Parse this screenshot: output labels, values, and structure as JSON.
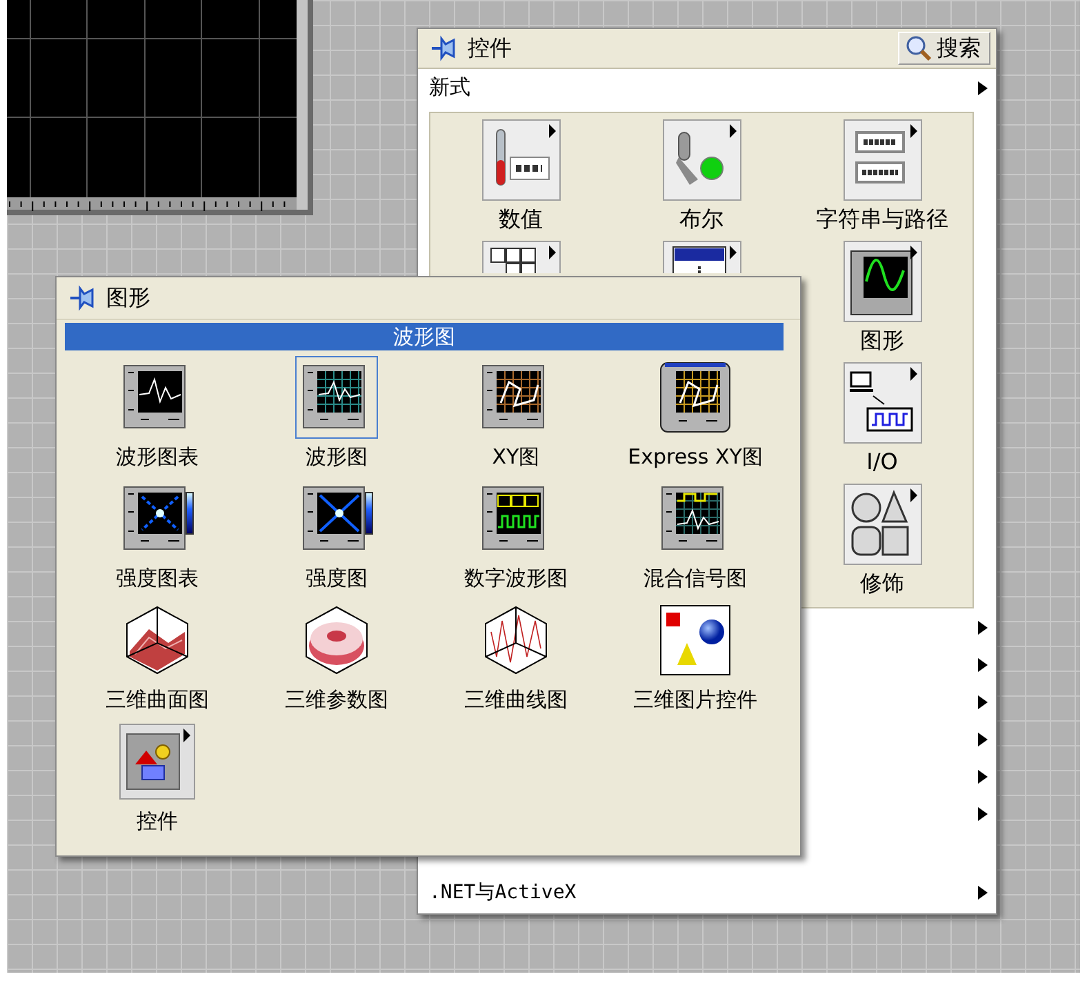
{
  "controls_palette": {
    "title": "控件",
    "search_button": "搜索",
    "rows": [
      {
        "label": "新式",
        "submenu": true
      }
    ],
    "columns": [
      {
        "items": [
          {
            "kind": "numeric",
            "label": "数值"
          },
          {
            "kind": "cluster"
          }
        ]
      },
      {
        "items": [
          {
            "kind": "boolean",
            "label": "布尔"
          },
          {
            "kind": "list"
          }
        ]
      },
      {
        "items": [
          {
            "kind": "string",
            "label": "字符串与路径"
          },
          {
            "kind": "graph",
            "label": "图形"
          },
          {
            "kind": "io",
            "label": "I/O"
          },
          {
            "kind": "decorations",
            "label": "修饰"
          }
        ]
      }
    ],
    "more_rows": [
      {
        "submenu": true
      },
      {
        "submenu": true
      },
      {
        "submenu": true
      },
      {
        "submenu": true
      },
      {
        "submenu": true
      },
      {
        "submenu": true
      },
      {
        "label": ".NET与ActiveX",
        "submenu": true
      }
    ]
  },
  "graph_palette": {
    "title": "图形",
    "section": "波形图",
    "items": [
      {
        "kind": "chart",
        "label": "波形图表",
        "selected": false
      },
      {
        "kind": "graph",
        "label": "波形图",
        "selected": true
      },
      {
        "kind": "xy",
        "label": "XY图",
        "selected": false
      },
      {
        "kind": "express_xy",
        "label": "Express XY图",
        "selected": false
      },
      {
        "kind": "intensity_chart",
        "label": "强度图表",
        "selected": false
      },
      {
        "kind": "intensity_graph",
        "label": "强度图",
        "selected": false
      },
      {
        "kind": "digital",
        "label": "数字波形图",
        "selected": false
      },
      {
        "kind": "mixed",
        "label": "混合信号图",
        "selected": false
      },
      {
        "kind": "surface",
        "label": "三维曲面图",
        "selected": false
      },
      {
        "kind": "parametric",
        "label": "三维参数图",
        "selected": false
      },
      {
        "kind": "curve",
        "label": "三维曲线图",
        "selected": false
      },
      {
        "kind": "picture",
        "label": "三维图片控件",
        "selected": false
      },
      {
        "kind": "controls",
        "label": "控件",
        "selected": false
      }
    ]
  }
}
